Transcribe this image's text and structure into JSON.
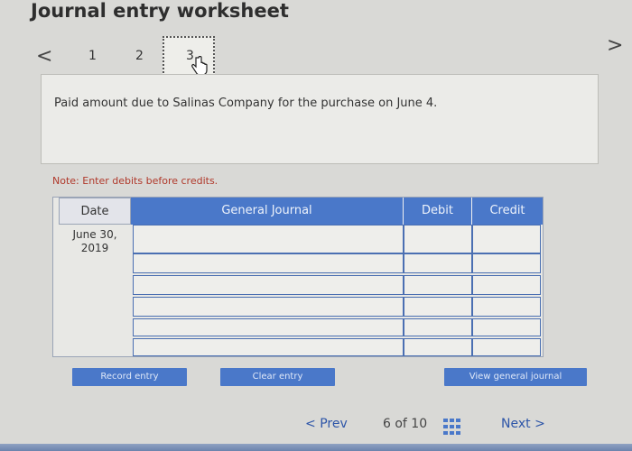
{
  "header": {
    "title": "Journal entry worksheet"
  },
  "steps": {
    "prev_glyph": "<",
    "next_glyph": ">",
    "items": [
      "1",
      "2",
      "3"
    ],
    "active": 3
  },
  "description": "Paid amount due to Salinas Company for the purchase on June 4.",
  "note": "Note: Enter debits before credits.",
  "journal": {
    "columns": {
      "date": "Date",
      "general_journal": "General Journal",
      "debit": "Debit",
      "credit": "Credit"
    },
    "date_value": "June 30, 2019",
    "rows": [
      {
        "account": "",
        "debit": "",
        "credit": ""
      },
      {
        "account": "",
        "debit": "",
        "credit": ""
      },
      {
        "account": "",
        "debit": "",
        "credit": ""
      },
      {
        "account": "",
        "debit": "",
        "credit": ""
      },
      {
        "account": "",
        "debit": "",
        "credit": ""
      },
      {
        "account": "",
        "debit": "",
        "credit": ""
      }
    ]
  },
  "buttons": {
    "record": "Record entry",
    "clear": "Clear entry",
    "view": "View general journal"
  },
  "pager": {
    "prev": "Prev",
    "page": "6 of 10",
    "next": "Next",
    "prev_glyph": "<",
    "next_glyph": ">"
  },
  "colors": {
    "accent": "#4a78c9",
    "note": "#b0392b",
    "link": "#2d55a8"
  }
}
